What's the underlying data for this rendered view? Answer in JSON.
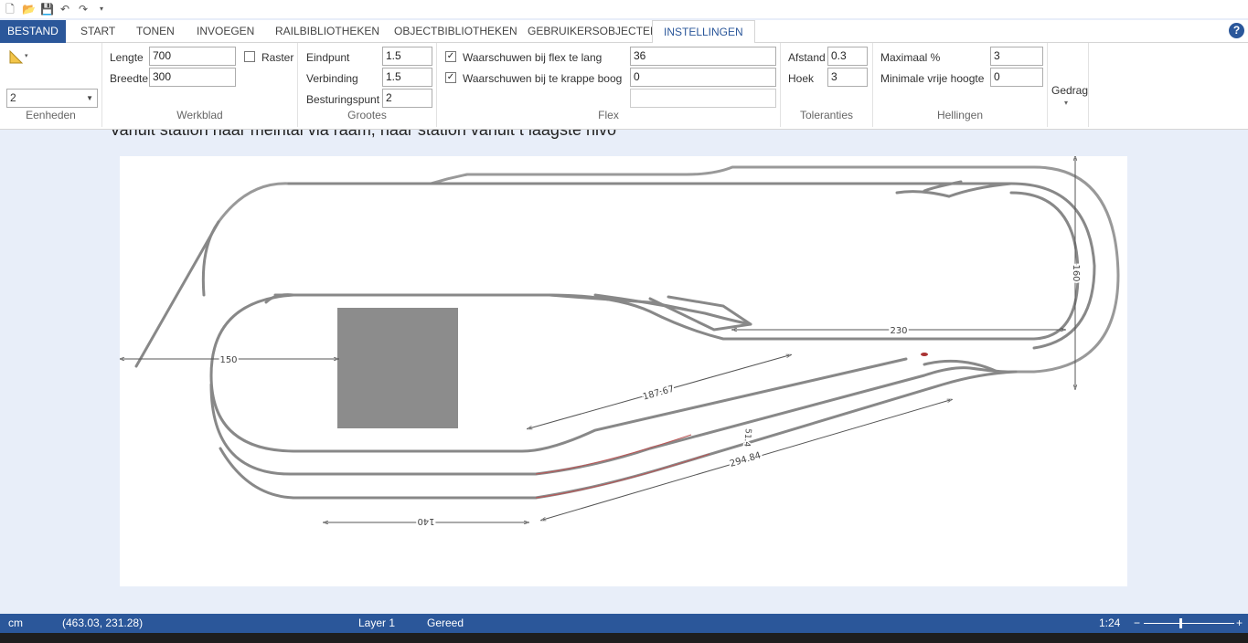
{
  "quick_access": {
    "icons": [
      "new-file-icon",
      "open-folder-icon",
      "save-icon",
      "undo-icon",
      "redo-icon",
      "customize-dropdown-icon"
    ]
  },
  "tabs": {
    "file": "BESTAND",
    "start": "START",
    "view": "TONEN",
    "insert": "INVOEGEN",
    "rail_library": "RAILBIBLIOTHEKEN",
    "object_library": "OBJECTBIBLIOTHEKEN",
    "user_objects": "GEBRUIKERSOBJECTEN",
    "settings": "INSTELLINGEN"
  },
  "help": "?",
  "ribbon": {
    "units": {
      "value": "2",
      "group_label": "Eenheden"
    },
    "worksheet": {
      "length_label": "Lengte",
      "length_value": "700",
      "width_label": "Breedte",
      "width_value": "300",
      "group_label": "Werkblad"
    },
    "grid": {
      "label": "Raster",
      "checked": false
    },
    "sizes": {
      "endpoint_label": "Eindpunt",
      "endpoint_value": "1.5",
      "connection_label": "Verbinding",
      "connection_value": "1.5",
      "control_label": "Besturingspunt",
      "control_value": "2",
      "group_label": "Grootes"
    },
    "flex": {
      "warn_long_label": "Waarschuwen bij flex te lang",
      "warn_long_value": "36",
      "warn_long_checked": true,
      "warn_curve_label": "Waarschuwen bij te krappe boog",
      "warn_curve_value": "0",
      "warn_curve_checked": true,
      "group_label": "Flex"
    },
    "tolerances": {
      "distance_label": "Afstand",
      "distance_value": "0.3",
      "angle_label": "Hoek",
      "angle_value": "3",
      "group_label": "Toleranties"
    },
    "slopes": {
      "max_label": "Maximaal %",
      "max_value": "3",
      "min_height_label": "Minimale vrije hoogte",
      "min_height_value": "0",
      "group_label": "Hellingen"
    },
    "behavior": {
      "label": "Gedrag"
    }
  },
  "canvas": {
    "title": "Vanuit station naar meintal via raam, naar station vanuit t laagste nivo",
    "dimensions": [
      "230",
      "160",
      "150",
      "187.67",
      "294.84",
      "140",
      "51.4"
    ]
  },
  "status": {
    "unit": "cm",
    "coords": "(463.03, 231.28)",
    "layer": "Layer 1",
    "state": "Gereed",
    "zoom": "1:24",
    "zoom_minus": "−",
    "zoom_plus": "+"
  },
  "colors": {
    "accent": "#2b579a",
    "track": "#8c8c8c",
    "block": "#8c8c8c"
  }
}
